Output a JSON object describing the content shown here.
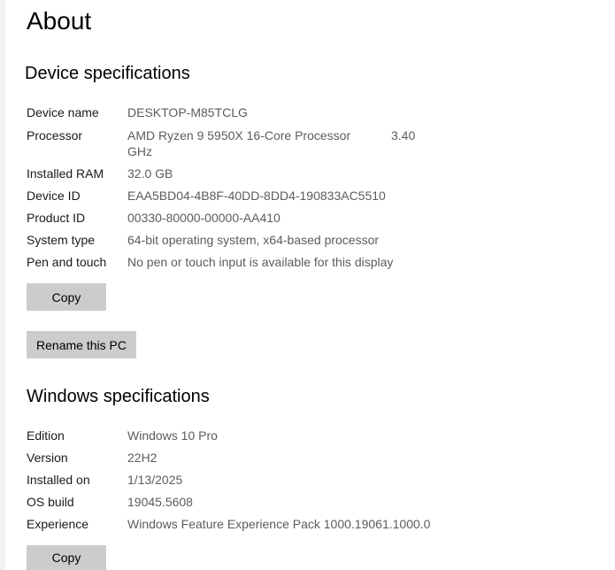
{
  "page": {
    "title": "About"
  },
  "device": {
    "heading": "Device specifications",
    "rows": [
      {
        "label": "Device name",
        "value": "DESKTOP-M85TCLG"
      },
      {
        "label": "Processor",
        "value": "AMD Ryzen 9 5950X 16-Core Processor",
        "value_extra": "3.40",
        "value_line2": "GHz"
      },
      {
        "label": "Installed RAM",
        "value": "32.0 GB"
      },
      {
        "label": "Device ID",
        "value": "EAA5BD04-4B8F-40DD-8DD4-190833AC5510"
      },
      {
        "label": "Product ID",
        "value": "00330-80000-00000-AA410"
      },
      {
        "label": "System type",
        "value": "64-bit operating system, x64-based processor"
      },
      {
        "label": "Pen and touch",
        "value": "No pen or touch input is available for this display"
      }
    ],
    "copy_label": "Copy",
    "rename_label": "Rename this PC"
  },
  "windows": {
    "heading": "Windows specifications",
    "rows": [
      {
        "label": "Edition",
        "value": "Windows 10 Pro"
      },
      {
        "label": "Version",
        "value": "22H2"
      },
      {
        "label": "Installed on",
        "value": "1/13/2025"
      },
      {
        "label": "OS build",
        "value": "19045.5608"
      },
      {
        "label": "Experience",
        "value": "Windows Feature Experience Pack 1000.19061.1000.0"
      }
    ],
    "copy_label": "Copy"
  }
}
